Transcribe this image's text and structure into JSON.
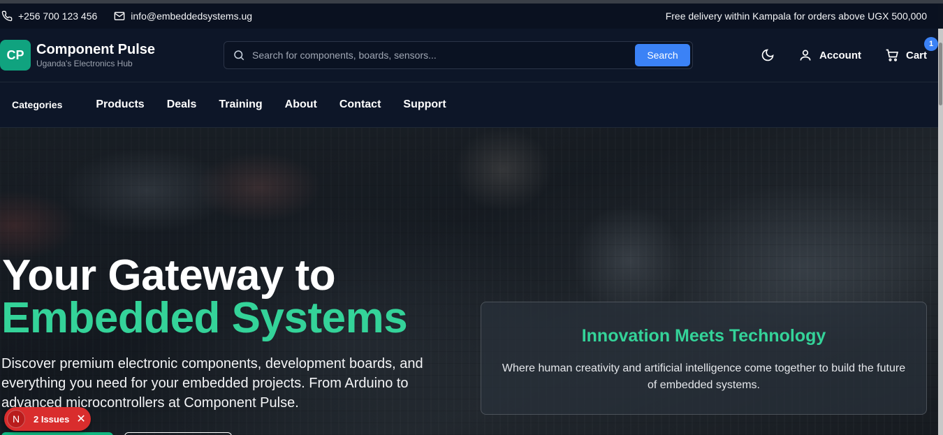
{
  "topbar": {
    "phone": "+256 700 123 456",
    "email": "info@embeddedsystems.ug",
    "promo": "Free delivery within Kampala for orders above UGX 500,000"
  },
  "header": {
    "logo_initials": "CP",
    "brand_name": "Component Pulse",
    "tagline": "Uganda's Electronics Hub",
    "search_placeholder": "Search for components, boards, sensors...",
    "search_button": "Search",
    "account_label": "Account",
    "cart_label": "Cart",
    "cart_count": "1"
  },
  "nav": {
    "categories": "Categories",
    "links": [
      "Products",
      "Deals",
      "Training",
      "About",
      "Contact",
      "Support"
    ]
  },
  "hero": {
    "title_line1": "Your Gateway to",
    "title_line2": "Embedded Systems",
    "lead": "Discover premium electronic components, development boards, and everything you need for your embedded projects. From Arduino to advanced microcontrollers at Component Pulse.",
    "card_title": "Innovation Meets Technology",
    "card_text": "Where human creativity and artificial intelligence come together to build the future of embedded systems."
  },
  "issues_badge": {
    "initial": "N",
    "label": "2 Issues",
    "close": "✕"
  },
  "colors": {
    "accent_green": "#34d399",
    "brand_green": "#10a37f",
    "primary_blue": "#3b82f6",
    "issue_red": "#d92d2d"
  }
}
